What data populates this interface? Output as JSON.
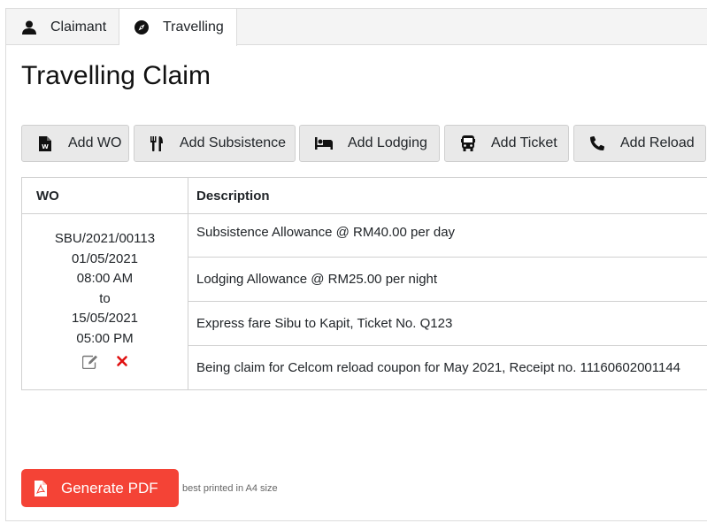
{
  "tabs": [
    {
      "label": "Claimant",
      "icon": "user-icon"
    },
    {
      "label": "Travelling",
      "icon": "compass-icon"
    }
  ],
  "page_title": "Travelling Claim",
  "actions": {
    "add_wo": "Add WO",
    "add_subsistence": "Add Subsistence",
    "add_lodging": "Add Lodging",
    "add_ticket": "Add Ticket",
    "add_reload": "Add Reload"
  },
  "table": {
    "headers": {
      "wo": "WO",
      "description": "Description"
    },
    "wo_entry": {
      "number": "SBU/2021/00113",
      "start_date": "01/05/2021",
      "start_time": "08:00 AM",
      "separator": "to",
      "end_date": "15/05/2021",
      "end_time": "05:00 PM"
    },
    "descriptions": [
      "Subsistence Allowance @ RM40.00 per day",
      "Lodging Allowance @ RM25.00 per night",
      "Express fare Sibu to Kapit, Ticket No. Q123",
      "Being claim for Celcom reload coupon for May 2021, Receipt no. 11160602001144"
    ]
  },
  "footer": {
    "generate_pdf": "Generate PDF",
    "note": "best printed in A4 size"
  },
  "colors": {
    "pdf_button": "#f44336",
    "delete_icon": "#e01010",
    "button_bg": "#e9e9e9"
  }
}
